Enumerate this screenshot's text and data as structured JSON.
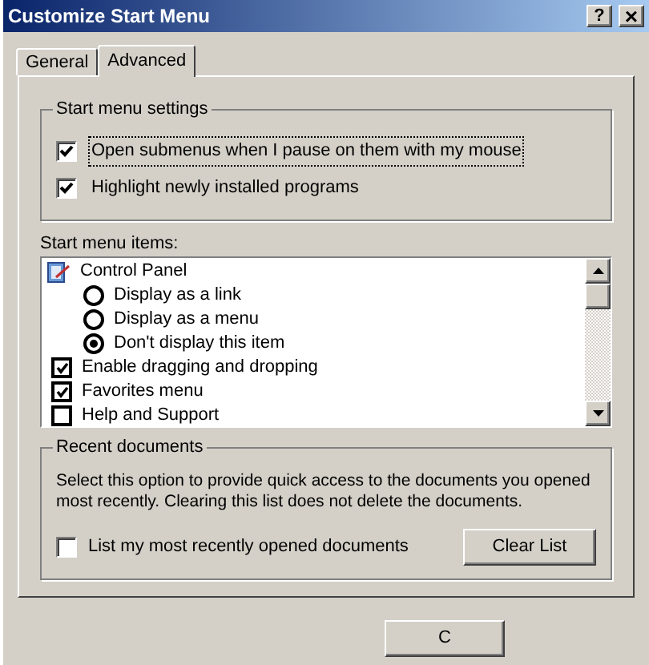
{
  "window": {
    "title": "Customize Start Menu",
    "buttons": [
      {
        "kind": "help",
        "label": "?"
      },
      {
        "kind": "close",
        "label": "×"
      }
    ]
  },
  "tabs": [
    {
      "label": "General",
      "selected": false
    },
    {
      "label": "Advanced",
      "selected": true
    }
  ],
  "settings_group": {
    "title": "Start menu settings",
    "options": [
      {
        "label": "Open submenus when I pause on them with my mouse",
        "checked": true,
        "focused": true
      },
      {
        "label": "Highlight newly installed programs",
        "checked": true,
        "focused": false
      }
    ]
  },
  "items_list": {
    "label": "Start menu items:",
    "items": [
      {
        "kind": "group",
        "label": "Control Panel",
        "children": [
          {
            "kind": "radio",
            "label": "Display as a link",
            "selected": false
          },
          {
            "kind": "radio",
            "label": "Display as a menu",
            "selected": false
          },
          {
            "kind": "radio",
            "label": "Don't display this item",
            "selected": true
          }
        ]
      },
      {
        "kind": "checkbox",
        "label": "Enable dragging and dropping",
        "checked": true
      },
      {
        "kind": "checkbox",
        "label": "Favorites menu",
        "checked": true
      },
      {
        "kind": "checkbox",
        "label": "Help and Support",
        "checked": false
      }
    ]
  },
  "recent_group": {
    "title": "Recent documents",
    "description": "Select this option to provide quick access to the documents you opened most recently.  Clearing this list does not delete the documents.",
    "option": {
      "label": "List my most recently opened documents",
      "checked": false
    },
    "button": "Clear List"
  },
  "dialog_buttons": [
    "C"
  ]
}
